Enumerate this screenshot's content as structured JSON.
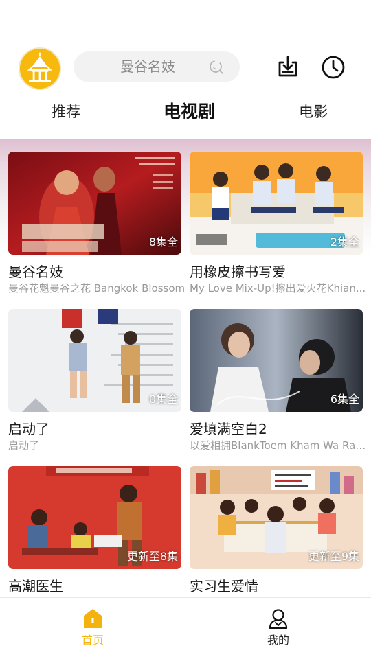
{
  "header": {
    "search_text": "曼谷名妓"
  },
  "tabs": [
    {
      "label": "推荐"
    },
    {
      "label": "电视剧"
    },
    {
      "label": "电影"
    }
  ],
  "cards": [
    {
      "title": "曼谷名妓",
      "subtitle": "曼谷花魁曼谷之花 Bangkok Blossom",
      "badge": "8集全"
    },
    {
      "title": "用橡皮擦书写爱",
      "subtitle": "My Love Mix-Up!擦出爱火花Khian...",
      "badge": "2集全"
    },
    {
      "title": "启动了",
      "subtitle": "启动了",
      "badge": "0集全"
    },
    {
      "title": "爱填满空白2",
      "subtitle": "以爱相拥BlankToem Kham Wa Rak...",
      "badge": "6集全"
    },
    {
      "title": "高潮医生",
      "subtitle": "",
      "badge": "更新至8集"
    },
    {
      "title": "实习生爱情",
      "subtitle": "",
      "badge": "更新至9集"
    }
  ],
  "bottom_nav": [
    {
      "label": "首页",
      "active": true
    },
    {
      "label": "我的",
      "active": false
    }
  ],
  "colors": {
    "accent": "#f4b20f",
    "search_bg": "#f2f2f2",
    "subtitle": "#9a9a9a"
  }
}
